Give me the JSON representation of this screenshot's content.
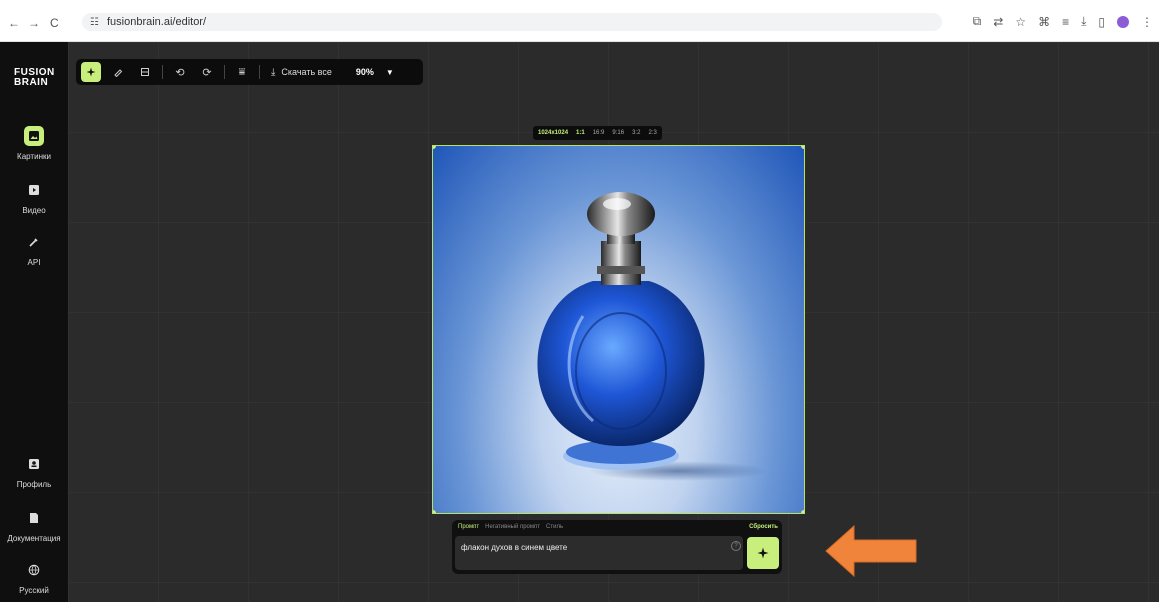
{
  "browser": {
    "url": "fusionbrain.ai/editor/",
    "nav": [
      "←",
      "→",
      "C"
    ],
    "icons": [
      "cast-icon",
      "translate-icon",
      "star-icon",
      "extensions-icon",
      "tab-search-icon",
      "download-icon",
      "sidebar-icon",
      "profile-icon",
      "menu-icon"
    ]
  },
  "sidebar": {
    "logo_line1": "FUSION",
    "logo_line2": "BRAIN",
    "items": [
      {
        "label": "Картинки",
        "icon": "image-icon",
        "active": true
      },
      {
        "label": "Видео",
        "icon": "video-icon",
        "active": false
      },
      {
        "label": "API",
        "icon": "plug-icon",
        "active": false
      }
    ],
    "bottom_items": [
      {
        "label": "Профиль",
        "icon": "profile-icon"
      },
      {
        "label": "Документация",
        "icon": "document-icon"
      },
      {
        "label": "Русский",
        "icon": "globe-icon"
      }
    ]
  },
  "toolbar": {
    "download_label": "Скачать все",
    "zoom": "90%"
  },
  "ratio_bar": {
    "options": [
      "1024x1024",
      "1:1",
      "16:9",
      "9:16",
      "3:2",
      "2:3"
    ],
    "selected": "1024x1024"
  },
  "prompt": {
    "tabs": [
      "Промпт",
      "Негативный промпт",
      "Стиль"
    ],
    "active_tab": "Промпт",
    "reset_label": "Сбросить",
    "value": "флакон духов в синем цвете"
  },
  "colors": {
    "accent": "#c8ef7b",
    "annotation_arrow": "#f0843a"
  }
}
